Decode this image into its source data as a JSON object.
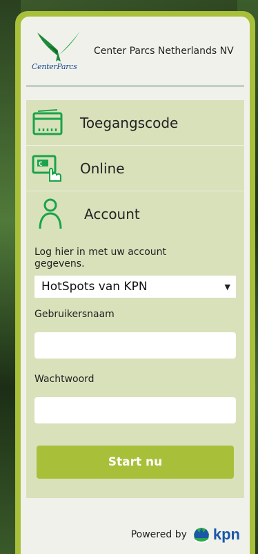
{
  "header": {
    "company_name": "Center Parcs Netherlands NV",
    "logo_text": "CenterParcs"
  },
  "menu": {
    "items": [
      {
        "label": "Toegangscode",
        "icon": "voucher-card-icon"
      },
      {
        "label": "Online",
        "icon": "online-payment-icon"
      }
    ],
    "account": {
      "label": "Account",
      "icon": "user-account-icon",
      "help_text": "Log hier in met uw account gegevens.",
      "provider_selected": "HotSpots van KPN",
      "username_label": "Gebruikersnaam",
      "username_value": "",
      "password_label": "Wachtwoord",
      "password_value": "",
      "submit_label": "Start nu"
    }
  },
  "footer": {
    "powered_by": "Powered by",
    "brand": "kpn"
  },
  "colors": {
    "accent": "#a8bf3a",
    "icon_green": "#1aa34a",
    "panel": "#d9e1bb",
    "brand_blue": "#1a57a8"
  }
}
